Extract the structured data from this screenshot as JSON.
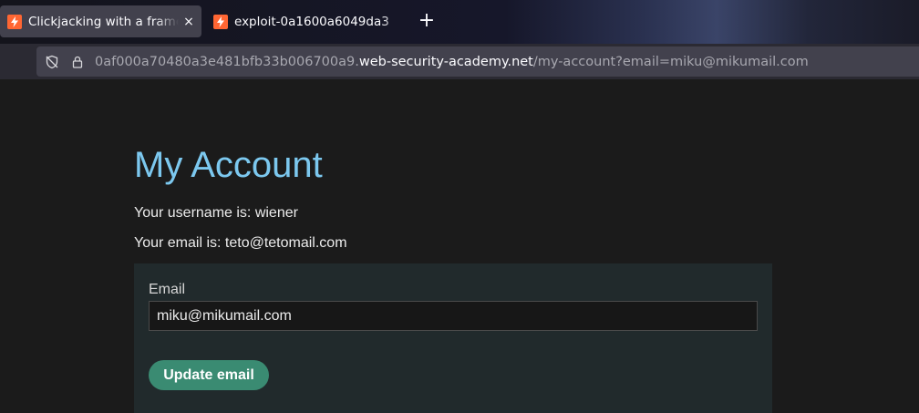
{
  "browser": {
    "tabs": [
      {
        "title": "Clickjacking with a frame",
        "active": true,
        "close_icon": "×",
        "favicon": "bolt-icon"
      },
      {
        "title": "exploit-0a1600a6049da3",
        "active": false,
        "close_icon": "×",
        "favicon": "bolt-icon"
      }
    ],
    "new_tab_icon": "+",
    "url": {
      "prefix": "0af000a70480a3e481bfb33b006700a9.",
      "host": "web-security-academy.net",
      "path": "/my-account?email=miku@mikumail.com"
    }
  },
  "page": {
    "title": "My Account",
    "username_line": "Your username is: wiener",
    "email_line": "Your email is: teto@tetomail.com",
    "form": {
      "email_label": "Email",
      "email_value": "miku@mikumail.com",
      "submit_label": "Update email"
    }
  },
  "colors": {
    "heading": "#7cc8ef",
    "button": "#3a8b72",
    "favicon": "#ff6633"
  }
}
